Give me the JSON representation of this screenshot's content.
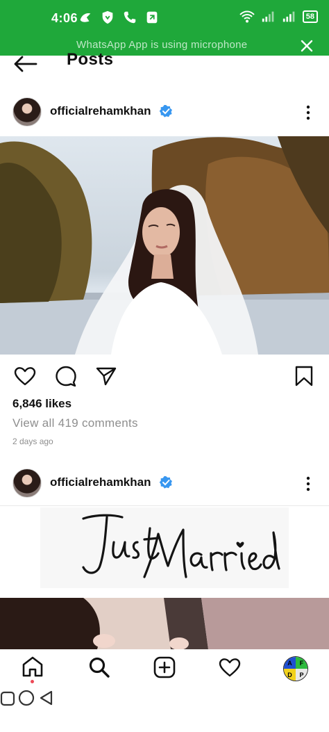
{
  "status_bar": {
    "time": "4:06",
    "battery": "58",
    "mic_banner": "WhatsApp App is using microphone",
    "bg_color": "#1fa83a"
  },
  "header": {
    "title": "Posts"
  },
  "posts": [
    {
      "username": "officialrehamkhan",
      "likes": "6,846 likes",
      "comments_link": "View all 419 comments",
      "timestamp": "2 days ago"
    },
    {
      "username": "officialrehamkhan",
      "image_text": "Just Married"
    }
  ],
  "bottom_nav": {
    "items": [
      "home-icon",
      "search-icon",
      "create-icon",
      "activity-heart-icon",
      "profile-avatar"
    ],
    "profile_letters": [
      "A",
      "F",
      "D",
      "P"
    ]
  },
  "colors": {
    "verified": "#3897f0",
    "notification_dot": "#ed4956"
  }
}
